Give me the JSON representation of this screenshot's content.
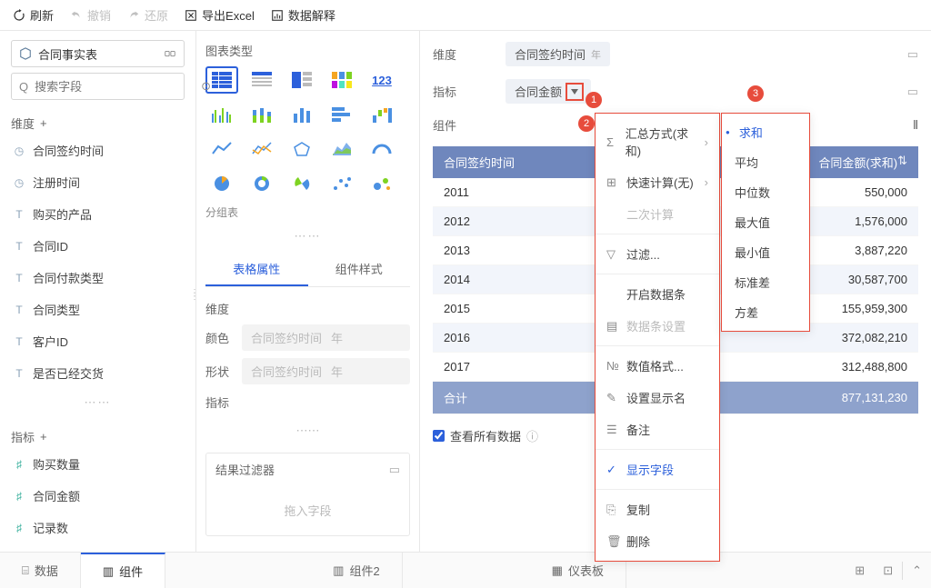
{
  "toolbar": {
    "refresh": "刷新",
    "undo": "撤销",
    "redo": "还原",
    "export": "导出Excel",
    "explain": "数据解释"
  },
  "sidebar": {
    "source": "合同事实表",
    "search_ph": "搜索字段",
    "dim_label": "维度",
    "metric_label": "指标",
    "dims": [
      {
        "icon": "clock",
        "label": "合同签约时间"
      },
      {
        "icon": "clock",
        "label": "注册时间"
      },
      {
        "icon": "T",
        "label": "购买的产品"
      },
      {
        "icon": "T",
        "label": "合同ID"
      },
      {
        "icon": "T",
        "label": "合同付款类型"
      },
      {
        "icon": "T",
        "label": "合同类型"
      },
      {
        "icon": "T",
        "label": "客户ID"
      },
      {
        "icon": "T",
        "label": "是否已经交货"
      }
    ],
    "metrics": [
      {
        "label": "购买数量"
      },
      {
        "label": "合同金额"
      },
      {
        "label": "记录数"
      }
    ]
  },
  "mid": {
    "chart_type": "图表类型",
    "group_table": "分组表",
    "tab_attr": "表格属性",
    "tab_style": "组件样式",
    "sec_dim": "维度",
    "sec_metric": "指标",
    "color": "颜色",
    "shape": "形状",
    "pill_text1": "合同签约时间",
    "pill_text2": "年",
    "filter_title": "结果过滤器",
    "filter_drop": "拖入字段"
  },
  "right": {
    "dim_label": "维度",
    "dim_pill": "合同签约时间",
    "dim_unit": "年",
    "metric_label": "指标",
    "metric_pill": "合同金额",
    "comp_label": "组件",
    "col1": "合同签约时间",
    "col2": "合同金额(求和)",
    "rows": [
      {
        "y": "2011",
        "v": "550,000"
      },
      {
        "y": "2012",
        "v": "1,576,000"
      },
      {
        "y": "2013",
        "v": "3,887,220"
      },
      {
        "y": "2014",
        "v": "30,587,700"
      },
      {
        "y": "2015",
        "v": "155,959,300"
      },
      {
        "y": "2016",
        "v": "372,082,210"
      },
      {
        "y": "2017",
        "v": "312,488,800"
      }
    ],
    "total_label": "合计",
    "total_val": "877,131,230",
    "viewall": "查看所有数据"
  },
  "menu1": {
    "agg": "汇总方式(求和)",
    "quick": "快速计算(无)",
    "secondary": "二次计算",
    "filter": "过滤...",
    "databar_on": "开启数据条",
    "databar_cfg": "数据条设置",
    "numfmt": "数值格式...",
    "dispname": "设置显示名",
    "note": "备注",
    "showfield": "显示字段",
    "copy": "复制",
    "delete": "删除"
  },
  "menu2": {
    "items": [
      "求和",
      "平均",
      "中位数",
      "最大值",
      "最小值",
      "标准差",
      "方差"
    ]
  },
  "bottom": {
    "data": "数据",
    "comp": "组件",
    "comp2": "组件2",
    "dash": "仪表板"
  },
  "badges": {
    "b1": "1",
    "b2": "2",
    "b3": "3"
  }
}
